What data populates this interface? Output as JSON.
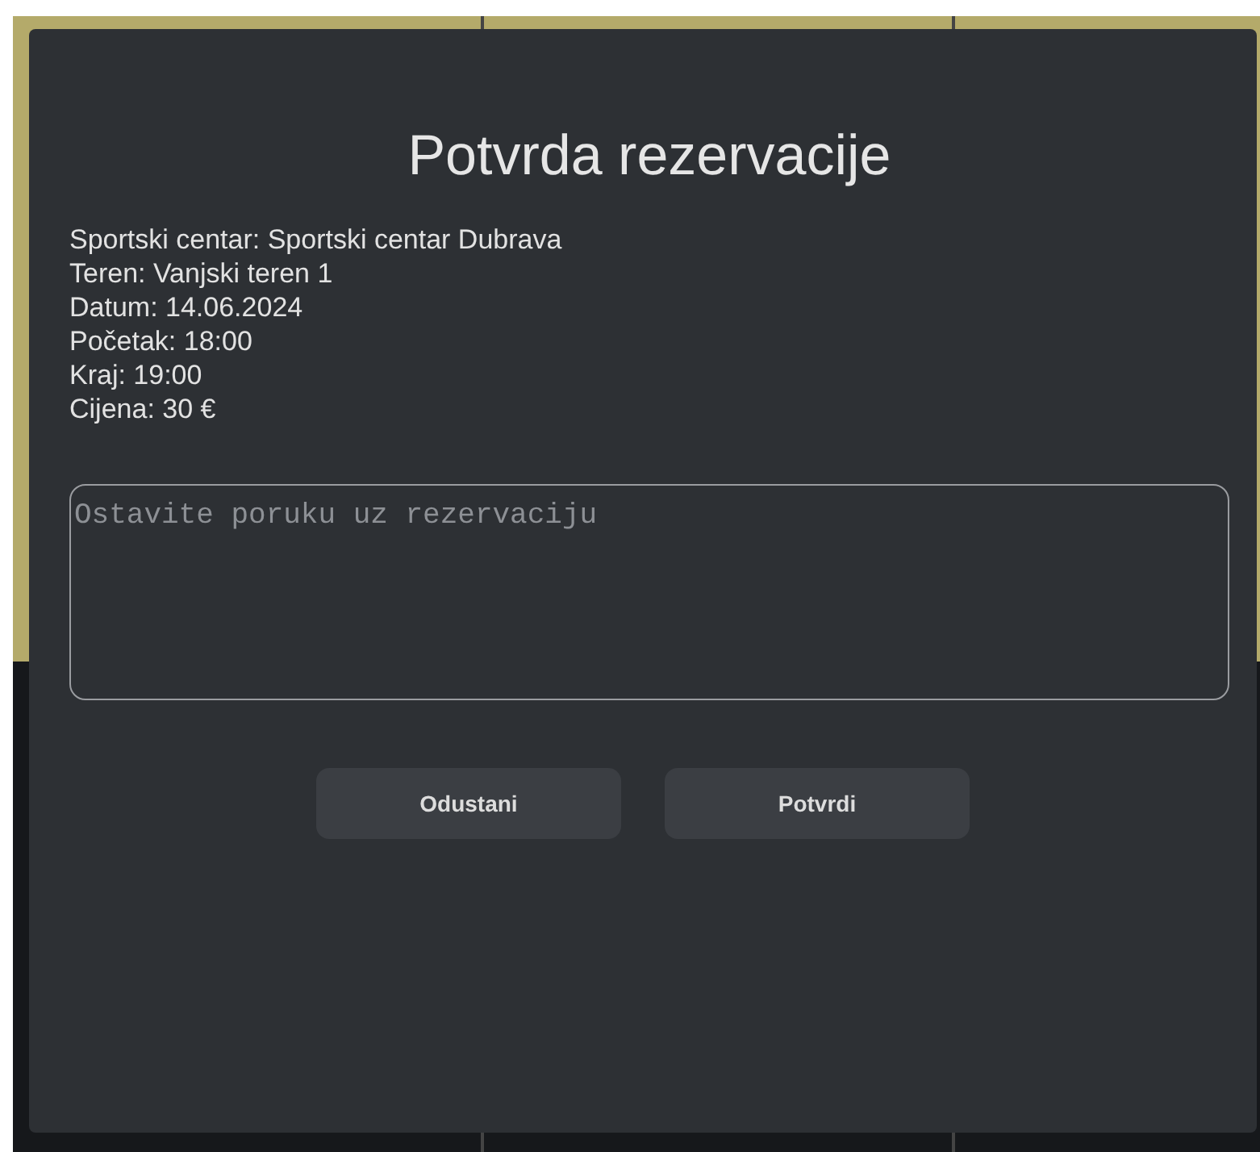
{
  "dialog": {
    "title": "Potvrda rezervacije",
    "details": [
      "Sportski centar: Sportski centar Dubrava",
      "Teren: Vanjski teren 1",
      "Datum: 14.06.2024",
      "Početak: 18:00",
      "Kraj: 19:00",
      "Cijena: 30 €"
    ],
    "message": {
      "placeholder": "Ostavite poruku uz rezervaciju"
    },
    "buttons": [
      "Odustani",
      "Potvrdi"
    ]
  }
}
